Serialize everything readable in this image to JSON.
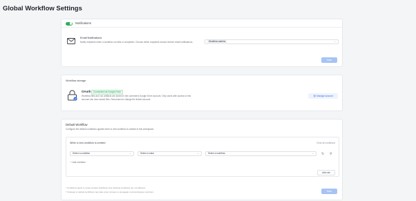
{
  "page": {
    "title": "Global Workflow Settings"
  },
  "notifications": {
    "toggle_label": "Notifications",
    "toggle_on": true,
    "email_title": "Email Notifications",
    "email_desc": "Notify recipients when a workflow run fails or completes. Choose which recipients should receive email notifications.",
    "select_value": "Workflow admins",
    "save_label": "Save"
  },
  "storage": {
    "header": "Workflow storage",
    "oauth_title": "OAuth",
    "oauth_badge": "Connected via Google Drive",
    "oauth_desc": "Workflow files and run artifacts are stored in the connected Google Drive account. Only users with access to this account can view stored files. Reconnect to change the linked account.",
    "link_label": "Manage account"
  },
  "workflow": {
    "title": "Default Workflow",
    "desc": "Configure the default conditions applied when a new workflow is created in this workspace.",
    "inner_head": "When a new workflow is created",
    "inner_link": "Clear all conditions",
    "conditions": [
      "Select a condition",
      "Select a value",
      "Select a workflow"
    ],
    "add_condition": "+ Add condition",
    "add_rule_label": "Add rule",
    "footnote_1": "* Conditions apply to newly created workflows only. Existing workflows are not affected.",
    "footnote_2": "* Changes to default workflows may take a few minutes to propagate to all workspace members.",
    "save_label": "Save"
  },
  "colors": {
    "accent": "#2fae5b",
    "primary_disabled": "#a7c3f4",
    "link": "#3b6fe0"
  }
}
